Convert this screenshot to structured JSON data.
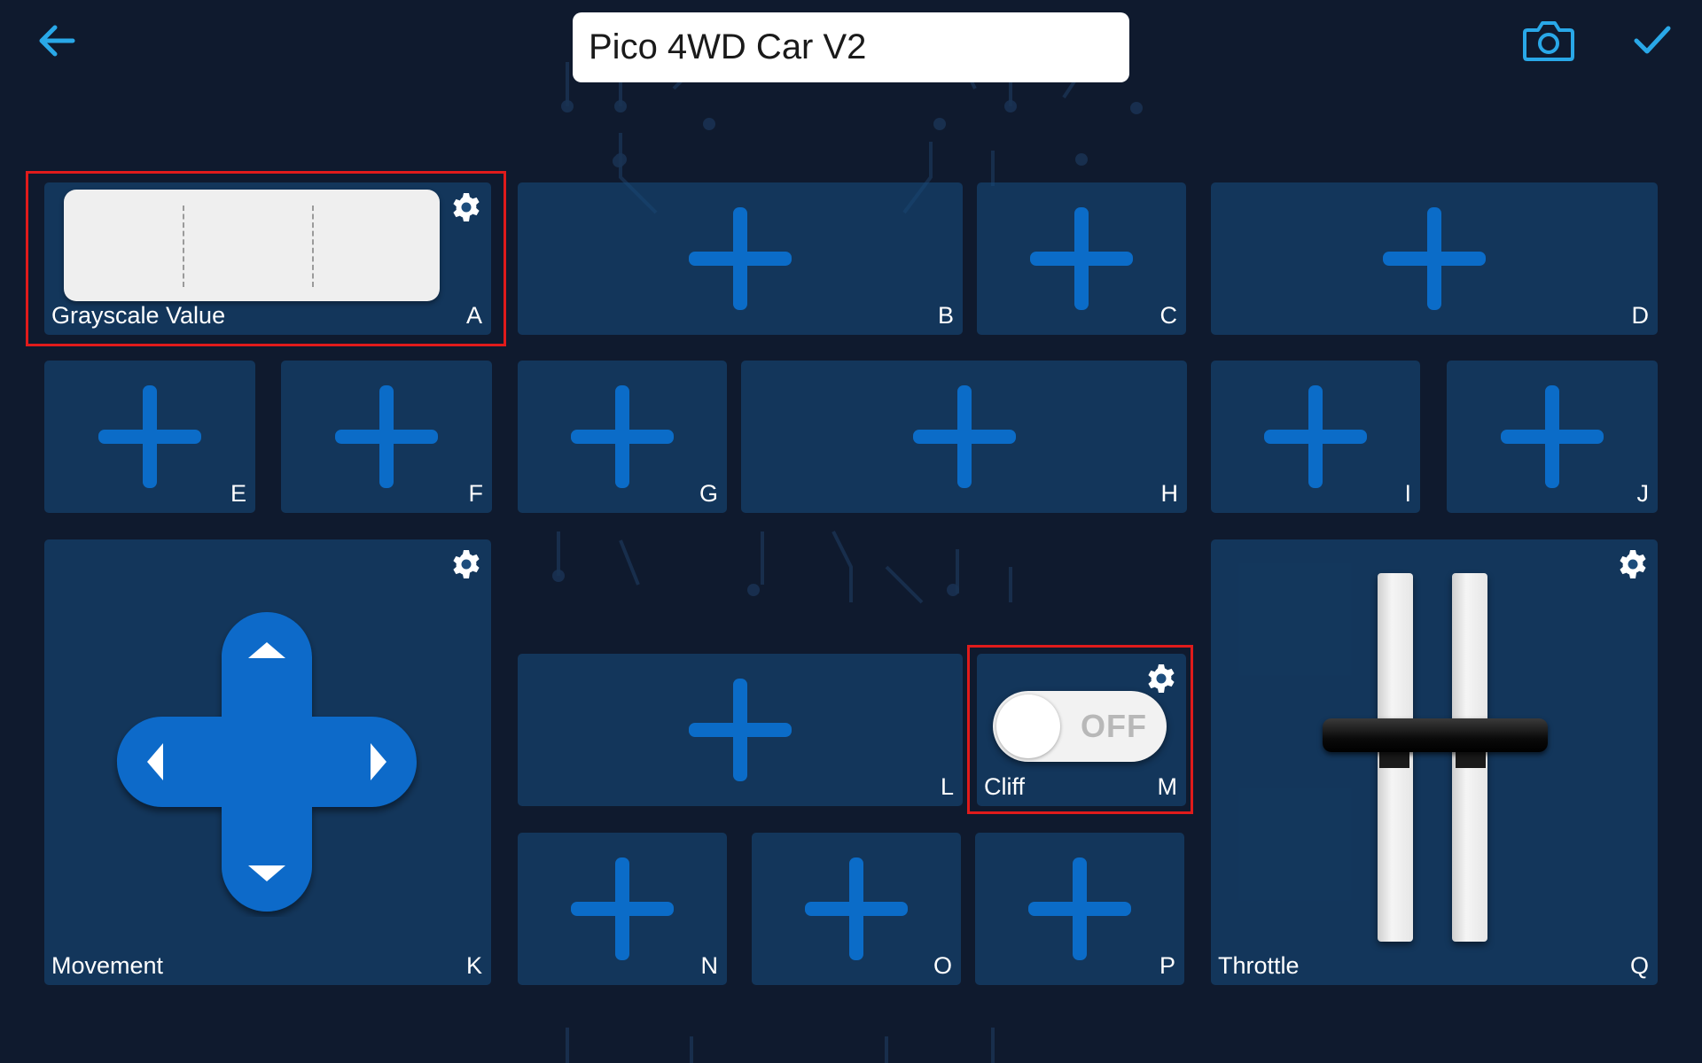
{
  "header": {
    "title_value": "Pico 4WD Car V2",
    "back_icon": "arrow-left-icon",
    "camera_icon": "camera-icon",
    "confirm_icon": "check-icon",
    "accent_color": "#29a8e8"
  },
  "widgets": {
    "A": {
      "letter": "A",
      "label": "Grayscale Value",
      "type": "grayscale-display"
    },
    "B": {
      "letter": "B"
    },
    "C": {
      "letter": "C"
    },
    "D": {
      "letter": "D"
    },
    "E": {
      "letter": "E"
    },
    "F": {
      "letter": "F"
    },
    "G": {
      "letter": "G"
    },
    "H": {
      "letter": "H"
    },
    "I": {
      "letter": "I"
    },
    "J": {
      "letter": "J"
    },
    "K": {
      "letter": "K",
      "label": "Movement",
      "type": "dpad"
    },
    "L": {
      "letter": "L"
    },
    "M": {
      "letter": "M",
      "label": "Cliff",
      "type": "switch",
      "state_text": "OFF"
    },
    "N": {
      "letter": "N"
    },
    "O": {
      "letter": "O"
    },
    "P": {
      "letter": "P"
    },
    "Q": {
      "letter": "Q",
      "label": "Throttle",
      "type": "throttle-slider"
    }
  },
  "colors": {
    "background": "#0f1a2e",
    "cell": "#1d4d7c",
    "plus": "#0b6cc8",
    "highlight": "#e01b1b",
    "dpad": "#0a6bc9"
  }
}
